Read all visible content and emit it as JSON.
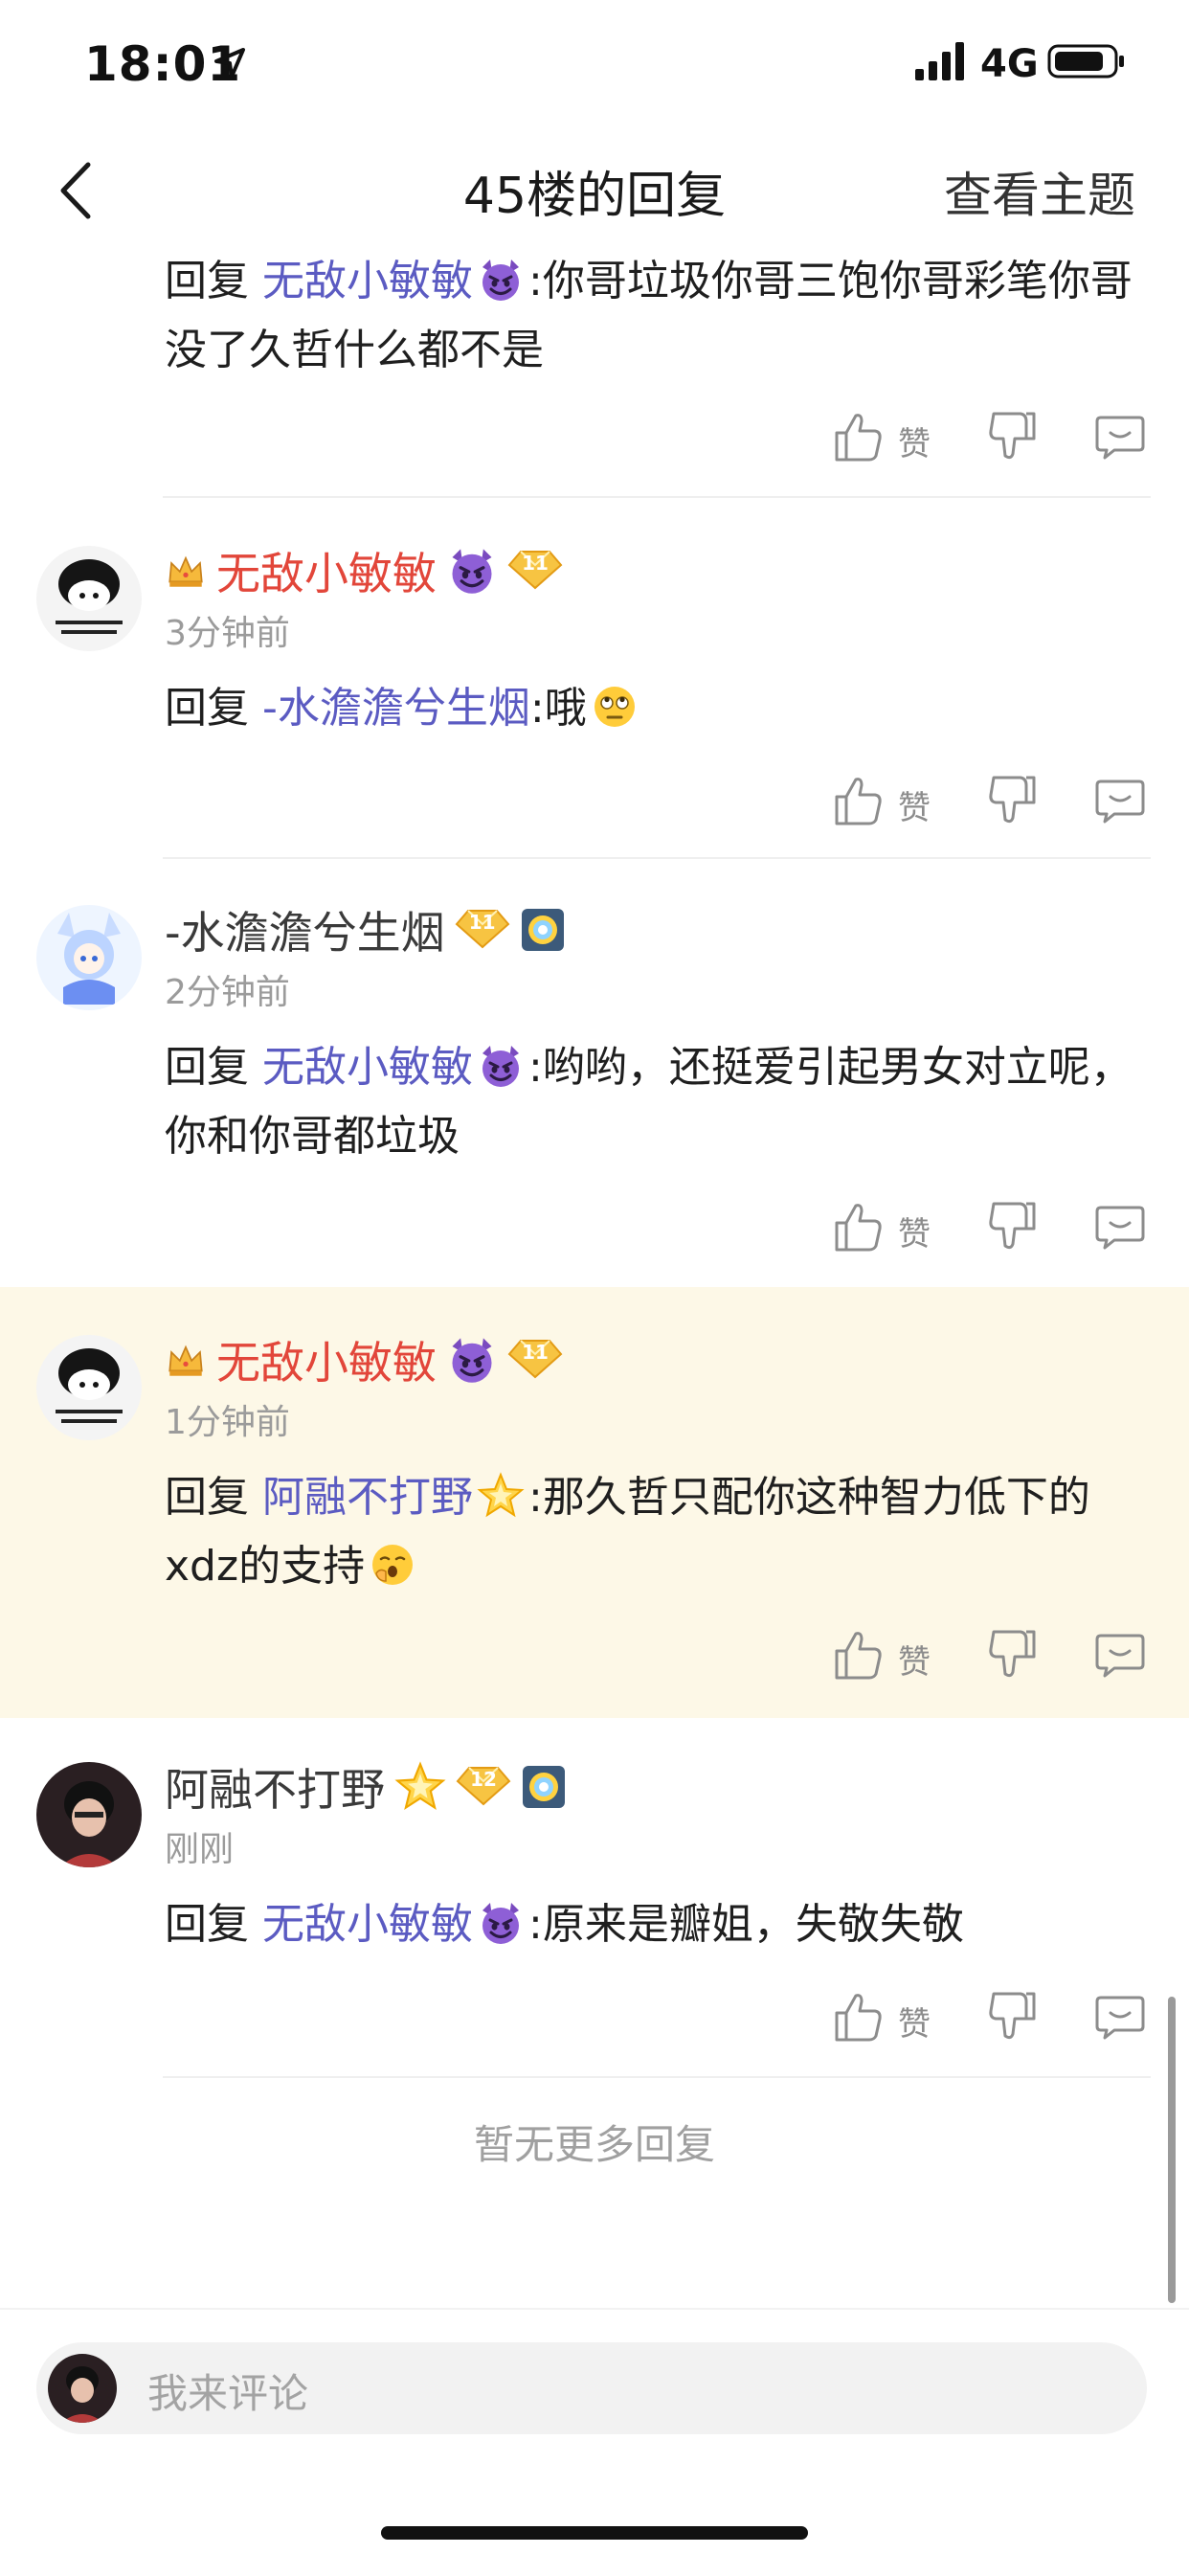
{
  "status_bar": {
    "time": "18:01",
    "network": "4G"
  },
  "nav": {
    "title": "45楼的回复",
    "right_action": "查看主题"
  },
  "common": {
    "reply_prefix": "回复",
    "like_label": "赞"
  },
  "top_reply": {
    "mention": "无敌小敏敏",
    "text": ":你哥垃圾你哥三饱你哥彩笔你哥没了久哲什么都不是"
  },
  "replies": [
    {
      "username": "无敌小敏敏",
      "level": "11",
      "time": "3分钟前",
      "mention": "-水澹澹兮生烟",
      "text": ":哦"
    },
    {
      "username": "-水澹澹兮生烟",
      "level": "11",
      "time": "2分钟前",
      "mention": "无敌小敏敏",
      "text": ":哟哟，还挺爱引起男女对立呢，你和你哥都垃圾"
    },
    {
      "username": "无敌小敏敏",
      "level": "11",
      "time": "1分钟前",
      "mention": "阿融不打野",
      "text": ":那久哲只配你这种智力低下的xdz的支持"
    },
    {
      "username": "阿融不打野",
      "level": "12",
      "time": "刚刚",
      "mention": "无敌小敏敏",
      "text": ":原来是瓣姐，失敬失敬"
    }
  ],
  "footer": {
    "no_more": "暂无更多回复"
  },
  "comment_bar": {
    "placeholder": "我来评论"
  },
  "colors": {
    "mention": "#5b5bc2",
    "username_red": "#e2463a",
    "highlight_bg": "#fdf8e7"
  }
}
